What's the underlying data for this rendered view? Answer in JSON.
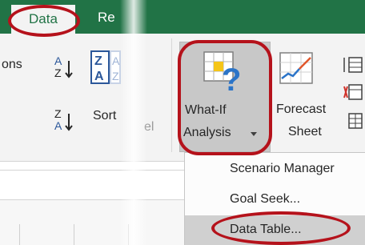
{
  "ribbon": {
    "tabs": [
      "Data",
      "Re"
    ],
    "left_partial_text": "ons",
    "sort_label": "Sort",
    "right_partial_text": "el",
    "what_if": {
      "line1": "What-If",
      "line2": "Analysis"
    },
    "forecast": {
      "line1": "Forecast",
      "line2": "Sheet"
    }
  },
  "menu": {
    "items": [
      {
        "label": "Scenario Manager"
      },
      {
        "label": "Goal Seek..."
      },
      {
        "label": "Data Table..."
      }
    ]
  },
  "colors": {
    "excel_green": "#217346",
    "annotation_red": "#b5121b",
    "ribbon_bg": "#f3f3f3"
  }
}
